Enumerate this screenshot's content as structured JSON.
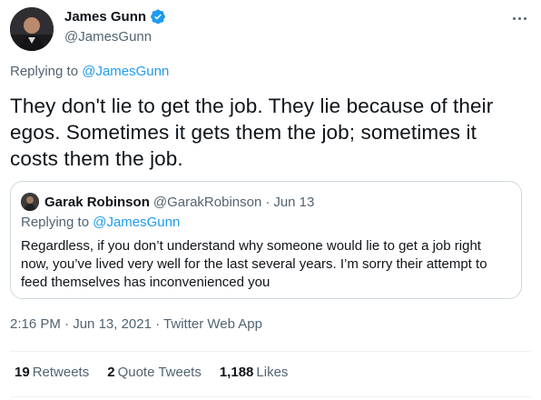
{
  "author": {
    "display_name": "James Gunn",
    "handle": "@JamesGunn",
    "verified": true,
    "verified_color": "#1d9bf0"
  },
  "tweet": {
    "replying_prefix": "Replying to ",
    "replying_to": "@JamesGunn",
    "text": "They don't lie to get the job. They lie because of their egos. Sometimes it gets them the job; sometimes it costs them the job.",
    "time": "2:16 PM",
    "sep": " · ",
    "date": "Jun 13, 2021",
    "source": "Twitter Web App"
  },
  "quote": {
    "display_name": "Garak Robinson",
    "handle": "@GarakRobinson",
    "sep": "·",
    "date": "Jun 13",
    "replying_prefix": "Replying to ",
    "replying_to": "@JamesGunn",
    "text": "Regardless, if you don’t understand why someone would lie to get a job right now, you’ve lived very well for the last several years. I’m sorry their attempt to feed themselves has inconvenienced you"
  },
  "stats": {
    "retweets_count": "19",
    "retweets_label": "Retweets",
    "quotes_count": "2",
    "quotes_label": "Quote Tweets",
    "likes_count": "1,188",
    "likes_label": "Likes"
  },
  "colors": {
    "link": "#1d9bf0",
    "secondary_text": "#536471",
    "border": "#cfd9de"
  }
}
